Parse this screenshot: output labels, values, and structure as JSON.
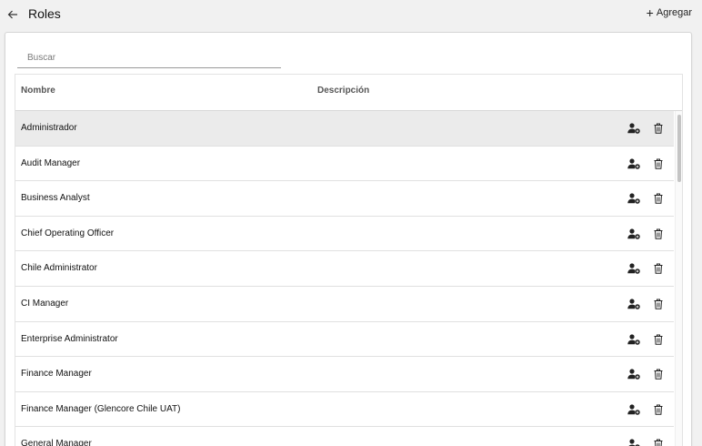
{
  "header": {
    "back_icon": "arrow-left-icon",
    "title": "Roles",
    "add_icon": "plus-icon",
    "add_label": "Agregar"
  },
  "search": {
    "placeholder": "Buscar",
    "value": ""
  },
  "table": {
    "columns": [
      "Nombre",
      "Descripción"
    ],
    "row_action_icons": [
      "user-gear-icon",
      "trash-icon"
    ],
    "rows": [
      {
        "name": "Administrador",
        "description": "",
        "selected": true
      },
      {
        "name": "Audit Manager",
        "description": ""
      },
      {
        "name": "Business Analyst",
        "description": ""
      },
      {
        "name": "Chief Operating Officer",
        "description": ""
      },
      {
        "name": "Chile Administrator",
        "description": ""
      },
      {
        "name": "CI Manager",
        "description": ""
      },
      {
        "name": "Enterprise Administrator",
        "description": ""
      },
      {
        "name": "Finance Manager",
        "description": ""
      },
      {
        "name": "Finance Manager (Glencore Chile UAT)",
        "description": ""
      },
      {
        "name": "General Manager",
        "description": ""
      }
    ]
  },
  "colors": {
    "background": "#f1f1f1",
    "selected_row": "#ebebeb",
    "icon": "#222222"
  }
}
